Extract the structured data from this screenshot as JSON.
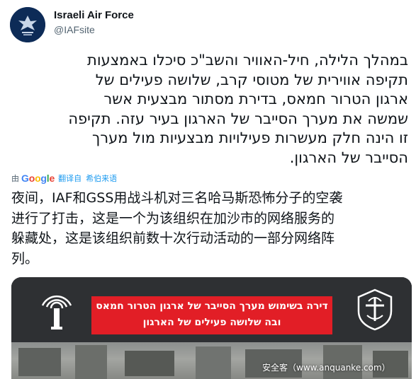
{
  "tweet": {
    "author_name": "Israeli Air Force",
    "author_handle": "@IAFsite",
    "text_lines": [
      "במהלך הלילה, חיל-האוויר והשב\"כ סיכלו באמצעות",
      "תקיפה אווירית של מטוסי קרב, שלושה פעילים של",
      "ארגון הטרור חמאס, בדירת מסתור מבצעית אשר",
      "שמשה את  מערך הסייבר של הארגון בעיר עזה. תקיפה",
      "זו הינה חלק מעשרות פעילויות מבצעיות מול מערך",
      "הסייבר של הארגון."
    ]
  },
  "translation": {
    "by_label": "由",
    "provider": "Google",
    "action_label": "翻译自",
    "language": "希伯来语",
    "text_lines": [
      "夜间，IAF和GSS用战斗机对三名哈马斯恐怖分子的空袭",
      "进行了打击，这是一个为该组织在加沙市的网络服务的",
      "躲藏处，这是该组织前数十次行动活动的一部分网络阵",
      "列。"
    ]
  },
  "media": {
    "banner_line1": "דירה בשימוש מערך הסייבר של ארגון הטרור חמאס",
    "banner_line2": "ובה שלושה פעילים של הארגון",
    "watermark": "安全客（www.anquanke.com）",
    "banner_color": "#e21e26"
  },
  "colors": {
    "link": "#1d9bf0",
    "secondary_text": "#536471",
    "avatar_bg": "#0d2b57"
  },
  "icons": {
    "avatar": "iaf-emblem-icon",
    "cyber": "cyber-unit-logo-icon",
    "idf": "idf-emblem-icon"
  }
}
